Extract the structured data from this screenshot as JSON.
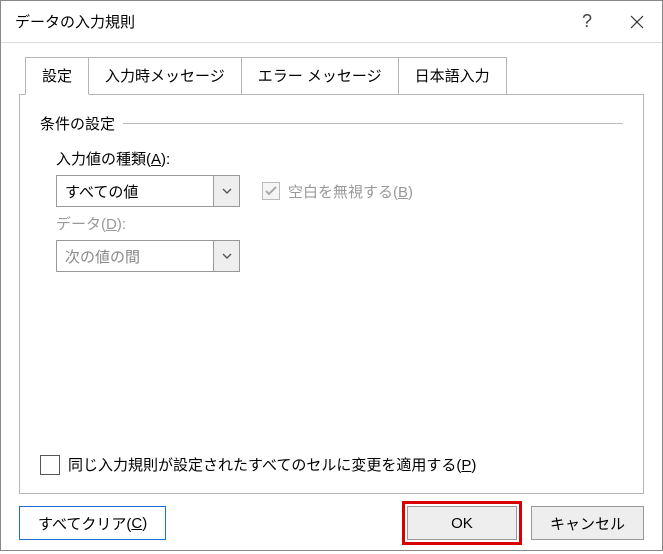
{
  "titlebar": {
    "title": "データの入力規則"
  },
  "tabs": {
    "settings": "設定",
    "input_msg": "入力時メッセージ",
    "error_msg": "エラー メッセージ",
    "ime": "日本語入力"
  },
  "group": {
    "legend": "条件の設定"
  },
  "allow": {
    "label_prefix": "入力値の種類(",
    "label_key": "A",
    "label_suffix": "):",
    "value": "すべての値"
  },
  "ignore_blank": {
    "label_prefix": "空白を無視する(",
    "label_key": "B",
    "label_suffix": ")"
  },
  "data_field": {
    "label_prefix": "データ(",
    "label_key": "D",
    "label_suffix": "):",
    "value": "次の値の間"
  },
  "apply_same": {
    "label_prefix": "同じ入力規則が設定されたすべてのセルに変更を適用する(",
    "label_key": "P",
    "label_suffix": ")"
  },
  "footer": {
    "clear_prefix": "すべてクリア(",
    "clear_key": "C",
    "clear_suffix": ")",
    "ok": "OK",
    "cancel": "キャンセル"
  }
}
